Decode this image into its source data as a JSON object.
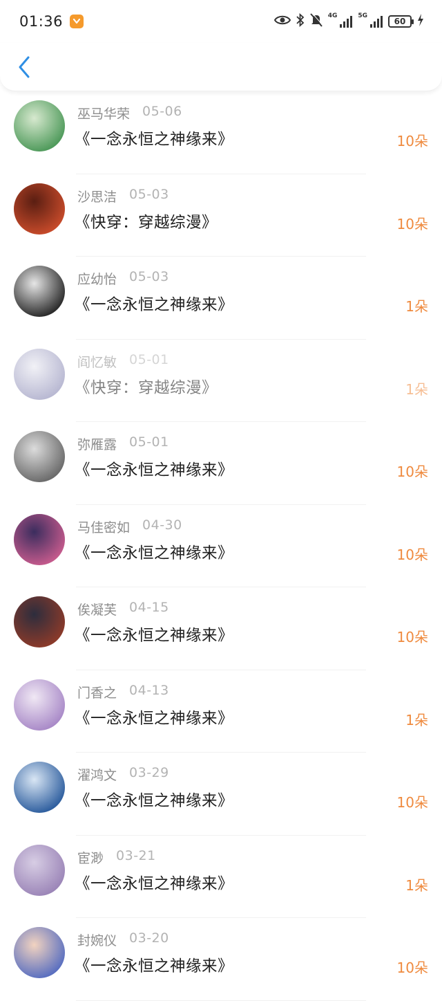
{
  "status": {
    "time": "01:36",
    "net1": "4G",
    "net2": "5G",
    "battery": "60"
  },
  "colors": {
    "accent_blue": "#2f8fe4",
    "gift_orange": "#ef8a3e",
    "app_badge": "#f59a2c"
  },
  "items": [
    {
      "name": "巫马华荣",
      "date": "05-06",
      "title": "《一念永恒之神缘来》",
      "gift": "10朵",
      "avatar_colors": [
        "#4f9a5b",
        "#d7e9cf"
      ]
    },
    {
      "name": "沙思洁",
      "date": "05-03",
      "title": "《快穿：穿越综漫》",
      "gift": "10朵",
      "avatar_colors": [
        "#c64a2a",
        "#5a1e12"
      ]
    },
    {
      "name": "应幼怡",
      "date": "05-03",
      "title": "《一念永恒之神缘来》",
      "gift": "1朵",
      "avatar_colors": [
        "#2b2b2b",
        "#e6e6e6"
      ]
    },
    {
      "name": "阎忆敏",
      "date": "05-01",
      "title": "《快穿：穿越综漫》",
      "gift": "1朵",
      "avatar_colors": [
        "#8a8ab5",
        "#e8e8f0"
      ]
    },
    {
      "name": "弥雁露",
      "date": "05-01",
      "title": "《一念永恒之神缘来》",
      "gift": "10朵",
      "avatar_colors": [
        "#6b6b6b",
        "#dcdcdc"
      ]
    },
    {
      "name": "马佳密如",
      "date": "04-30",
      "title": "《一念永恒之神缘来》",
      "gift": "10朵",
      "avatar_colors": [
        "#c45a8c",
        "#3b2d5e"
      ]
    },
    {
      "name": "俟凝芙",
      "date": "04-15",
      "title": "《一念永恒之神缘来》",
      "gift": "10朵",
      "avatar_colors": [
        "#8b3a2a",
        "#2d2d3d"
      ]
    },
    {
      "name": "门香之",
      "date": "04-13",
      "title": "《一念永恒之神缘来》",
      "gift": "1朵",
      "avatar_colors": [
        "#a98ac8",
        "#f0e8f4"
      ]
    },
    {
      "name": "濯鸿文",
      "date": "03-29",
      "title": "《一念永恒之神缘来》",
      "gift": "10朵",
      "avatar_colors": [
        "#2f5f9f",
        "#d9e6f4"
      ]
    },
    {
      "name": "宦渺",
      "date": "03-21",
      "title": "《一念永恒之神缘来》",
      "gift": "1朵",
      "avatar_colors": [
        "#9c86b8",
        "#d7cde4"
      ]
    },
    {
      "name": "封婉仪",
      "date": "03-20",
      "title": "《一念永恒之神缘来》",
      "gift": "10朵",
      "avatar_colors": [
        "#5a6fc0",
        "#f2d3c0"
      ]
    }
  ]
}
